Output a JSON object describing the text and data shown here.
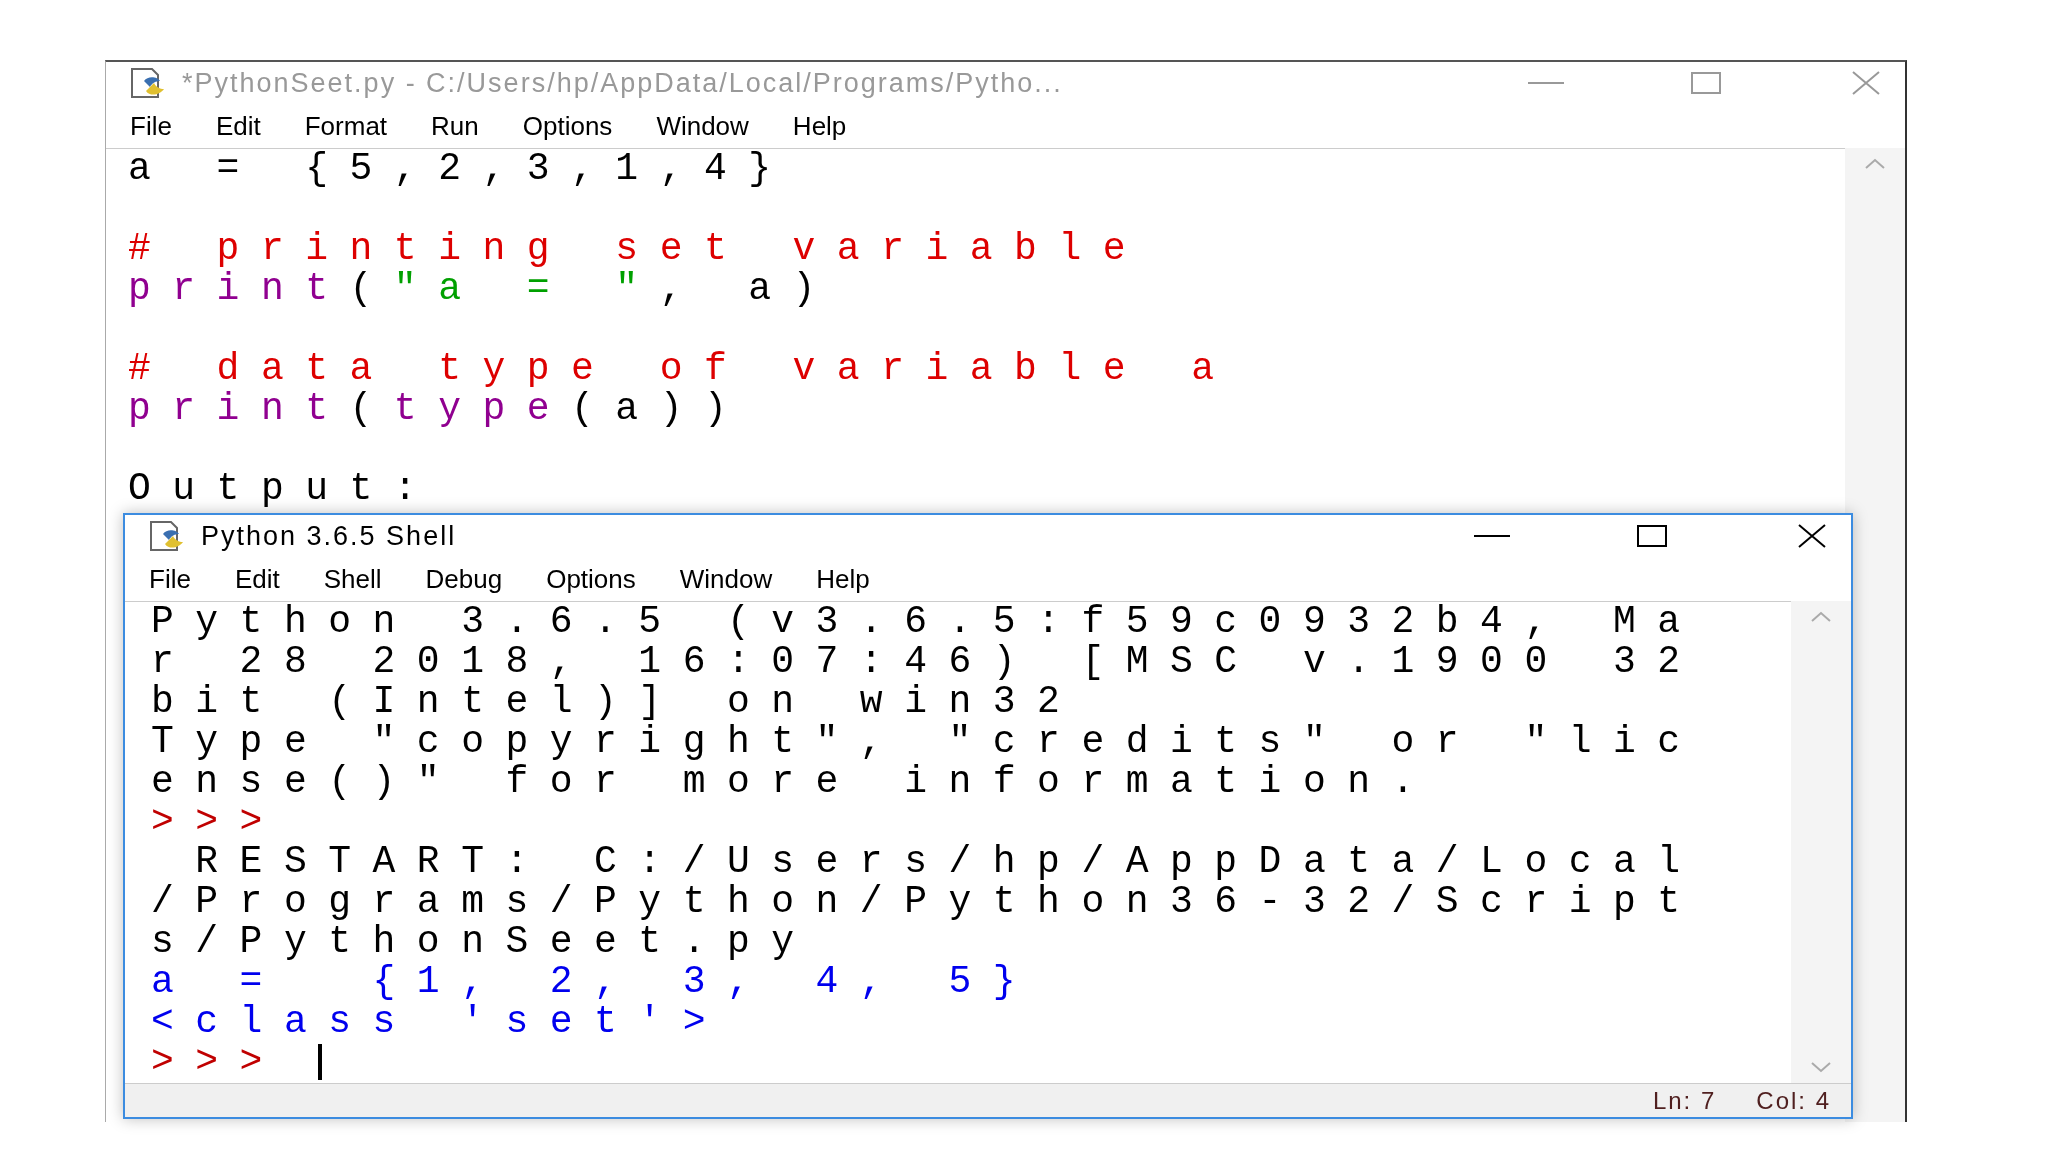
{
  "editor": {
    "title": "*PythonSeet.py - C:/Users/hp/AppData/Local/Programs/Pytho...",
    "active": false,
    "menu": [
      "File",
      "Edit",
      "Format",
      "Run",
      "Options",
      "Window",
      "Help"
    ],
    "blocks": [
      [
        [
          {
            "kind": "plain",
            "text": "a = {5,2,3,1,4}"
          }
        ]
      ],
      [
        [
          {
            "kind": "comment",
            "text": "# printing set variable"
          }
        ],
        [
          {
            "kind": "keyword",
            "text": "print"
          },
          {
            "kind": "plain",
            "text": "("
          },
          {
            "kind": "string",
            "text": "\"a = \""
          },
          {
            "kind": "plain",
            "text": ", a)"
          }
        ]
      ],
      [
        [
          {
            "kind": "comment",
            "text": "# data type of variable a"
          }
        ],
        [
          {
            "kind": "keyword",
            "text": "print"
          },
          {
            "kind": "plain",
            "text": "("
          },
          {
            "kind": "keyword",
            "text": "type"
          },
          {
            "kind": "plain",
            "text": "(a))"
          }
        ]
      ],
      [
        [
          {
            "kind": "plain",
            "text": "Output:"
          }
        ]
      ]
    ]
  },
  "shell": {
    "title": "Python 3.6.5 Shell",
    "active": true,
    "menu": [
      "File",
      "Edit",
      "Shell",
      "Debug",
      "Options",
      "Window",
      "Help"
    ],
    "lines": [
      {
        "kind": "banner",
        "text": "Python 3.6.5 (v3.6.5:f59c0932b4, Ma",
        "cursor": false
      },
      {
        "kind": "banner",
        "text": "r 28 2018, 16:07:46) [MSC v.1900 32",
        "cursor": false
      },
      {
        "kind": "banner",
        "text": "bit (Intel)] on win32",
        "cursor": false
      },
      {
        "kind": "banner",
        "text": "Type \"copyright\", \"credits\" or \"lic",
        "cursor": false
      },
      {
        "kind": "banner",
        "text": "ense()\" for more information.",
        "cursor": false
      },
      {
        "kind": "prompt",
        "text": ">>>",
        "cursor": false
      },
      {
        "kind": "banner",
        "text": " RESTART: C:/Users/hp/AppData/Local",
        "cursor": false
      },
      {
        "kind": "banner",
        "text": "/Programs/Python/Python36-32/Script",
        "cursor": false
      },
      {
        "kind": "banner",
        "text": "s/PythonSeet.py",
        "cursor": false
      },
      {
        "kind": "output",
        "text": "a =  {1, 2, 3, 4, 5}",
        "cursor": false
      },
      {
        "kind": "output",
        "text": "<class 'set'>",
        "cursor": false
      },
      {
        "kind": "prompt",
        "text": ">>> ",
        "cursor": true
      }
    ],
    "status": [
      "Ln: 7",
      "Col: 4"
    ]
  }
}
